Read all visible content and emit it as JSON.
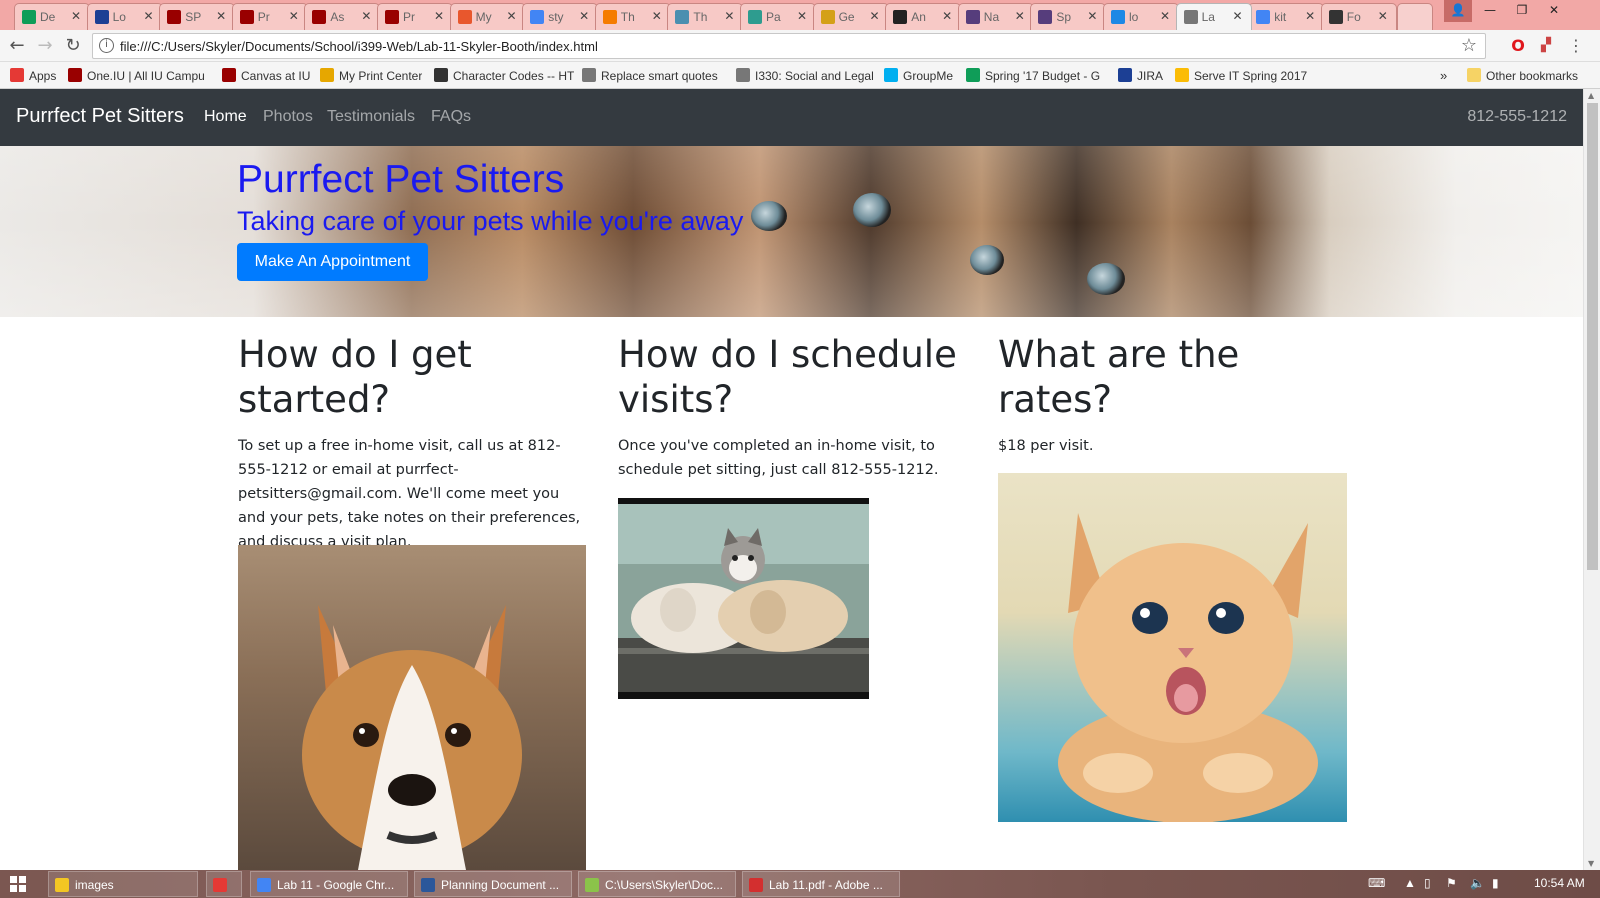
{
  "browser": {
    "tabs": [
      {
        "label": "De",
        "icon": "sheets-icon",
        "color": "#0f9d58"
      },
      {
        "label": "Lo",
        "icon": "jira-icon",
        "color": "#1c3f94"
      },
      {
        "label": "SP",
        "icon": "iu-trident-icon",
        "color": "#990000"
      },
      {
        "label": "Pr",
        "icon": "iu-trident-icon",
        "color": "#990000"
      },
      {
        "label": "As",
        "icon": "iu-trident-icon",
        "color": "#990000"
      },
      {
        "label": "Pr",
        "icon": "iu-trident-icon",
        "color": "#990000"
      },
      {
        "label": "My",
        "icon": "s-icon",
        "color": "#e8572d"
      },
      {
        "label": "sty",
        "icon": "google-icon",
        "color": "#4285f4"
      },
      {
        "label": "Th",
        "icon": "orange-grid-icon",
        "color": "#f57c00"
      },
      {
        "label": "Th",
        "icon": "m-icon",
        "color": "#4a8fb0"
      },
      {
        "label": "Pa",
        "icon": "p-icon",
        "color": "#2e9c8f"
      },
      {
        "label": "Ge",
        "icon": "crown-icon",
        "color": "#d4a017"
      },
      {
        "label": "An",
        "icon": "amazon-icon",
        "color": "#222222"
      },
      {
        "label": "Na",
        "icon": "bootstrap-icon",
        "color": "#563d7c"
      },
      {
        "label": "Sp",
        "icon": "bootstrap-icon",
        "color": "#563d7c"
      },
      {
        "label": "lo",
        "icon": "puzzle-icon",
        "color": "#1e88e5"
      },
      {
        "label": "La",
        "icon": "page-icon",
        "color": "#777777",
        "active": true
      },
      {
        "label": "kit",
        "icon": "google-icon",
        "color": "#4285f4"
      },
      {
        "label": "Fo",
        "icon": "folder-icon",
        "color": "#333333"
      }
    ],
    "url": "file:///C:/Users/Skyler/Documents/School/i399-Web/Lab-11-Skyler-Booth/index.html",
    "bookmarks": [
      {
        "label": "Apps",
        "icon": "apps-grid-icon",
        "color": "#e53935"
      },
      {
        "label": "One.IU | All IU Campu",
        "icon": "iu-icon",
        "color": "#990000"
      },
      {
        "label": "Canvas at IU",
        "icon": "iu-trident-icon",
        "color": "#990000"
      },
      {
        "label": "My Print Center",
        "icon": "hand-icon",
        "color": "#e6a700"
      },
      {
        "label": "Character Codes -- HT",
        "icon": "ampersand-icon",
        "color": "#333333"
      },
      {
        "label": "Replace smart quotes",
        "icon": "quote-icon",
        "color": "#777777"
      },
      {
        "label": "I330: Social and Legal",
        "icon": "page-icon",
        "color": "#777777"
      },
      {
        "label": "GroupMe",
        "icon": "groupme-icon",
        "color": "#00aff0"
      },
      {
        "label": "Spring '17 Budget - G",
        "icon": "sheets-icon",
        "color": "#0f9d58"
      },
      {
        "label": "JIRA",
        "icon": "jira-icon",
        "color": "#1c3f94"
      },
      {
        "label": "Serve IT Spring 2017",
        "icon": "drive-icon",
        "color": "#fbbc05"
      }
    ],
    "more_bookmarks": "»",
    "other_bookmarks": "Other bookmarks"
  },
  "site": {
    "brand": "Purrfect Pet Sitters",
    "nav": [
      {
        "label": "Home",
        "active": true
      },
      {
        "label": "Photos"
      },
      {
        "label": "Testimonials"
      },
      {
        "label": "FAQs"
      }
    ],
    "phone": "812-555-1212",
    "hero": {
      "title": "Purrfect Pet Sitters",
      "subtitle": "Taking care of your pets while you're away",
      "button": "Make An Appointment"
    },
    "columns": [
      {
        "heading": "How do I get started?",
        "text": "To set up a free in-home visit, call us at 812-555-1212 or email at purrfect-petsitters@gmail.com. We'll come meet you and your pets, take notes on their preferences, and discuss a visit plan.",
        "image": "corgi-puppy-photo"
      },
      {
        "heading": "How do I schedule visits?",
        "text": "Once you've completed an in-home visit, to schedule pet sitting, just call 812-555-1212.",
        "image": "puppies-and-kitten-photo"
      },
      {
        "heading": "What are the rates?",
        "text": "$18 per visit.",
        "image": "orange-kitten-photo"
      }
    ]
  },
  "taskbar": {
    "items": [
      {
        "label": "images",
        "icon": "folder-icon",
        "color": "#f3c623"
      },
      {
        "label": "",
        "icon": "xampp-icon",
        "color": "#e53935"
      },
      {
        "label": "Lab 11 - Google Chr...",
        "icon": "chrome-icon",
        "color": "#4285f4"
      },
      {
        "label": "Planning Document ...",
        "icon": "word-icon",
        "color": "#2b579a"
      },
      {
        "label": "C:\\Users\\Skyler\\Doc...",
        "icon": "notepad-icon",
        "color": "#8bc34a"
      },
      {
        "label": "Lab 11.pdf - Adobe ...",
        "icon": "pdf-icon",
        "color": "#d32f2f"
      }
    ],
    "clock": "10:54 AM"
  }
}
